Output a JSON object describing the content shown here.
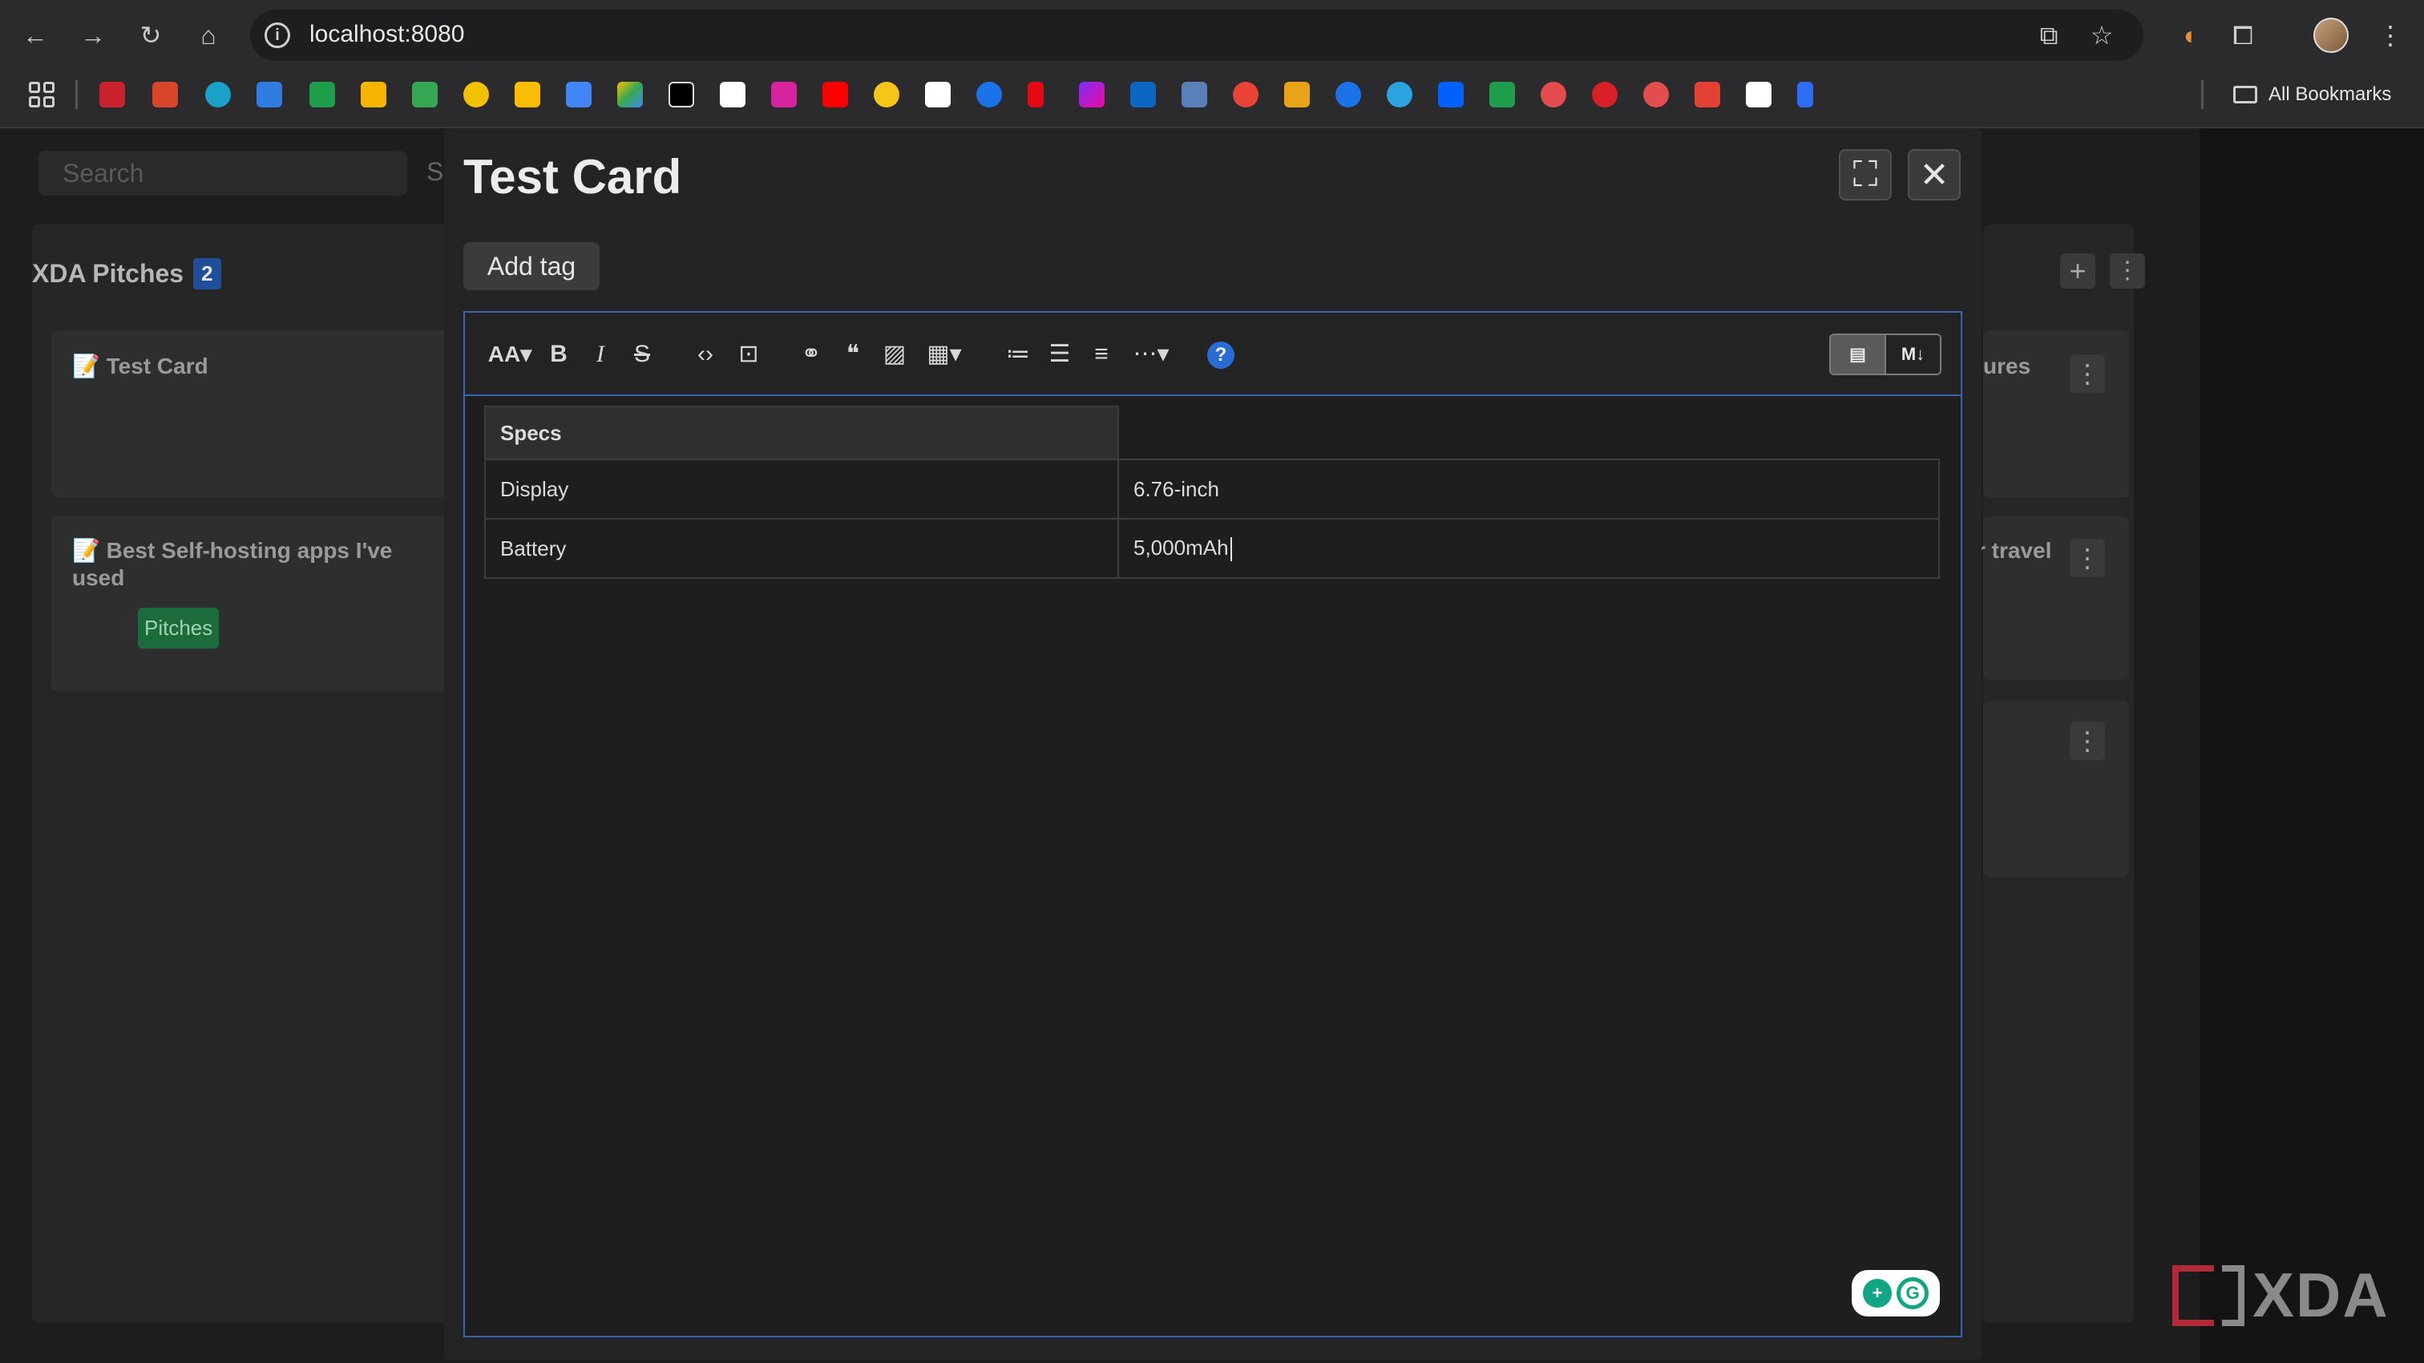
{
  "browser": {
    "url": "localhost:8080",
    "bookmarks_label": "All Bookmarks"
  },
  "board": {
    "search_placeholder": "Search",
    "search_suffix": "S",
    "column_title": "XDA Pitches",
    "column_count": "2",
    "cards": [
      {
        "title": "📝 Test Card"
      },
      {
        "title": "📝 Best Self-hosting apps I've used",
        "tag": "Pitches"
      }
    ],
    "right_card_fragments": [
      "ures",
      "r travel"
    ]
  },
  "modal": {
    "title": "Test Card",
    "add_tag_label": "Add tag",
    "toolbar": {
      "font_size": "AA",
      "bold": "B",
      "italic": "I",
      "strike": "S",
      "help": "?",
      "mode_markdown": "M↓"
    },
    "table": {
      "headers": [
        "Specs",
        ""
      ],
      "rows": [
        [
          "Display",
          "6.76-inch"
        ],
        [
          "Battery",
          "5,000mAh"
        ]
      ]
    }
  },
  "watermark": "XDA"
}
